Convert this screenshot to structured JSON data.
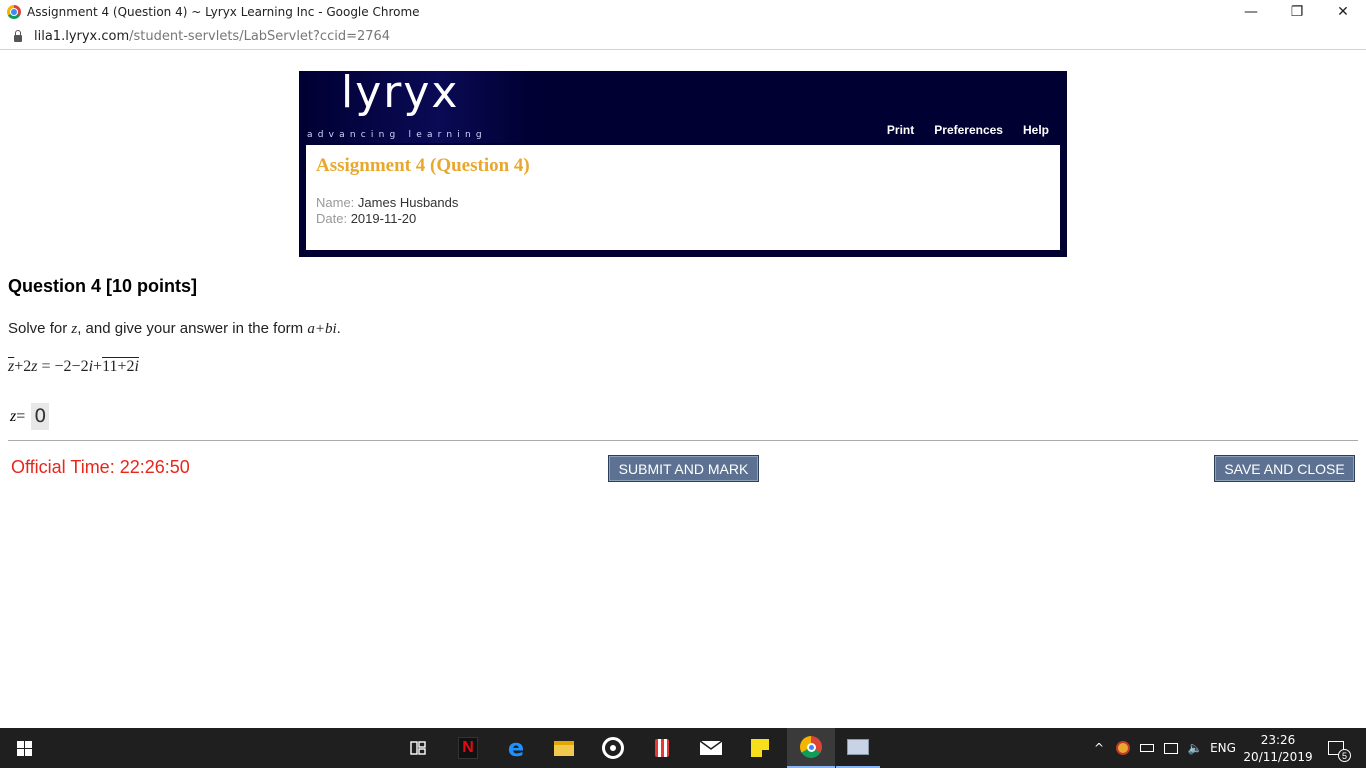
{
  "browser": {
    "window_title": "Assignment 4 (Question 4) ~ Lyryx Learning Inc - Google Chrome",
    "minimize": "—",
    "restore": "❐",
    "close": "✕",
    "url_host": "lila1.lyryx.com",
    "url_path": "/student-servlets/LabServlet?ccid=2764"
  },
  "header": {
    "logo": "lyryx",
    "tagline": "advancing learning",
    "nav": [
      "Print",
      "Preferences",
      "Help"
    ],
    "assignment_title": "Assignment 4 (Question 4)",
    "name_label": "Name:",
    "name_value": "James Husbands",
    "date_label": "Date:",
    "date_value": "2019-11-20"
  },
  "question": {
    "heading": "Question 4 [10 points]",
    "prompt_pre": "Solve for ",
    "prompt_var": "z",
    "prompt_mid": ", and give your answer in the form ",
    "prompt_form": "a+bi",
    "prompt_end": ".",
    "eq_zbar": "z",
    "eq_rest_1": "+2",
    "eq_z": "z",
    "eq_rest_2": " = −2−2",
    "eq_i": "i",
    "eq_rest_3": "+",
    "eq_conj": "11+2",
    "eq_conj_i": "i",
    "answer_var": "z",
    "answer_eq": " = ",
    "answer_value": "0"
  },
  "footer": {
    "official_time": "Official Time: 22:26:50",
    "submit_label": "SUBMIT AND MARK",
    "save_label": "SAVE AND CLOSE"
  },
  "taskbar": {
    "lang": "ENG",
    "time": "23:26",
    "date": "20/11/2019",
    "notifications": "5"
  }
}
